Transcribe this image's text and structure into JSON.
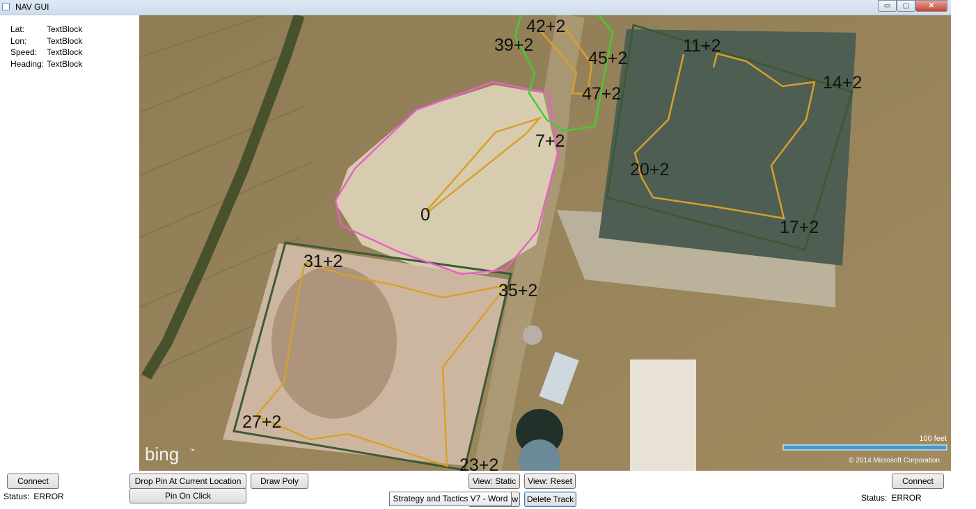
{
  "window": {
    "title": "NAV GUI",
    "controls": {
      "minimize": "▭",
      "maximize": "▢",
      "close": "✕"
    }
  },
  "telemetry": [
    {
      "label": "Lat:",
      "value": "TextBlock"
    },
    {
      "label": "Lon:",
      "value": "TextBlock"
    },
    {
      "label": "Speed:",
      "value": "TextBlock"
    },
    {
      "label": "Heading:",
      "value": "TextBlock"
    }
  ],
  "map": {
    "brand": "bing",
    "brand_mark": "™",
    "scale_label": "100 feet",
    "copyright": "© 2014 Microsoft Corporation",
    "colors": {
      "track": "#d6a02a",
      "pink_zone": "#e860c8",
      "green_zone": "#44cc33",
      "dark_zone": "#3b5a35",
      "scale_bar": "#3d9bd6"
    },
    "waypoints": [
      "0",
      "7+2",
      "11+2",
      "14+2",
      "17+2",
      "20+2",
      "23+2",
      "27+2",
      "31+2",
      "35+2",
      "39+2",
      "42+2",
      "45+2",
      "47+2"
    ]
  },
  "left_panel": {
    "connect_label": "Connect",
    "status_label": "Status:",
    "status_value": "ERROR"
  },
  "right_panel": {
    "connect_label": "Connect",
    "status_label": "Status:",
    "status_value": "ERROR"
  },
  "toolbar": {
    "drop_pin_label": "Drop Pin At Current Location",
    "pin_on_click_label": "Pin On Click",
    "draw_poly_label": "Draw Poly",
    "view_static_label": "View: Static",
    "view_reset_label": "View: Reset",
    "hidden_button_fragment": "w",
    "delete_track_label": "Delete Track"
  },
  "tooltip": {
    "text": "Strategy and Tactics V7 - Word"
  }
}
